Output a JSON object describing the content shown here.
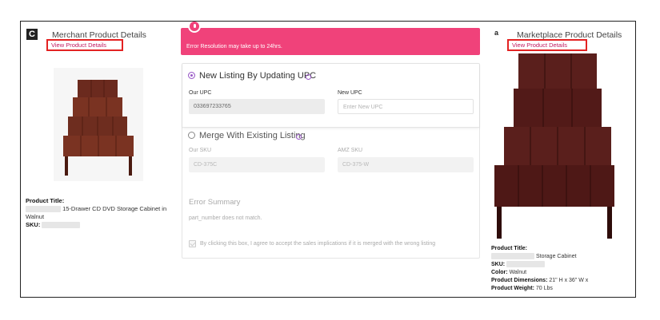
{
  "merchant": {
    "logo": "C",
    "title": "Merchant Product Details",
    "view_link": "View Product Details",
    "product_title_label": "Product Title:",
    "product_title_value": "15-Drawer CD DVD Storage Cabinet in Walnut",
    "sku_label": "SKU:"
  },
  "banner": {
    "text": "Error Resolution may take up to 24hrs.",
    "color": "#f0427a"
  },
  "option_update_upc": {
    "title": "New Listing By Updating UPC",
    "selected": true,
    "our_upc_label": "Our UPC",
    "our_upc_value": "033697233765",
    "new_upc_label": "New UPC",
    "new_upc_placeholder": "Enter New UPC"
  },
  "option_merge": {
    "title": "Merge With Existing Listing",
    "selected": false,
    "our_sku_label": "Our SKU",
    "our_sku_value": "CD-375C",
    "amz_sku_label": "AMZ SKU",
    "amz_sku_value": "CD-375-W"
  },
  "error_summary": {
    "title": "Error Summary",
    "message": "part_number does not match."
  },
  "agreement": {
    "text": "By clicking this box, I agree to accept the sales implications if it is merged with the wrong listing",
    "checked": true
  },
  "marketplace": {
    "logo": "a",
    "title": "Marketplace Product Details",
    "view_link": "View Product Details",
    "product_title_label": "Product Title:",
    "product_title_value": "Storage Cabinet",
    "sku_label": "SKU:",
    "color_label": "Color:",
    "color_value": "Walnut",
    "dimensions_label": "Product Dimensions:",
    "dimensions_value": "21\" H x 36\" W x",
    "weight_label": "Product Weight:",
    "weight_value": "70 Lbs"
  },
  "colors": {
    "accent": "#9a5bc7",
    "highlight_box": "#e32222",
    "link": "#c0185f"
  }
}
